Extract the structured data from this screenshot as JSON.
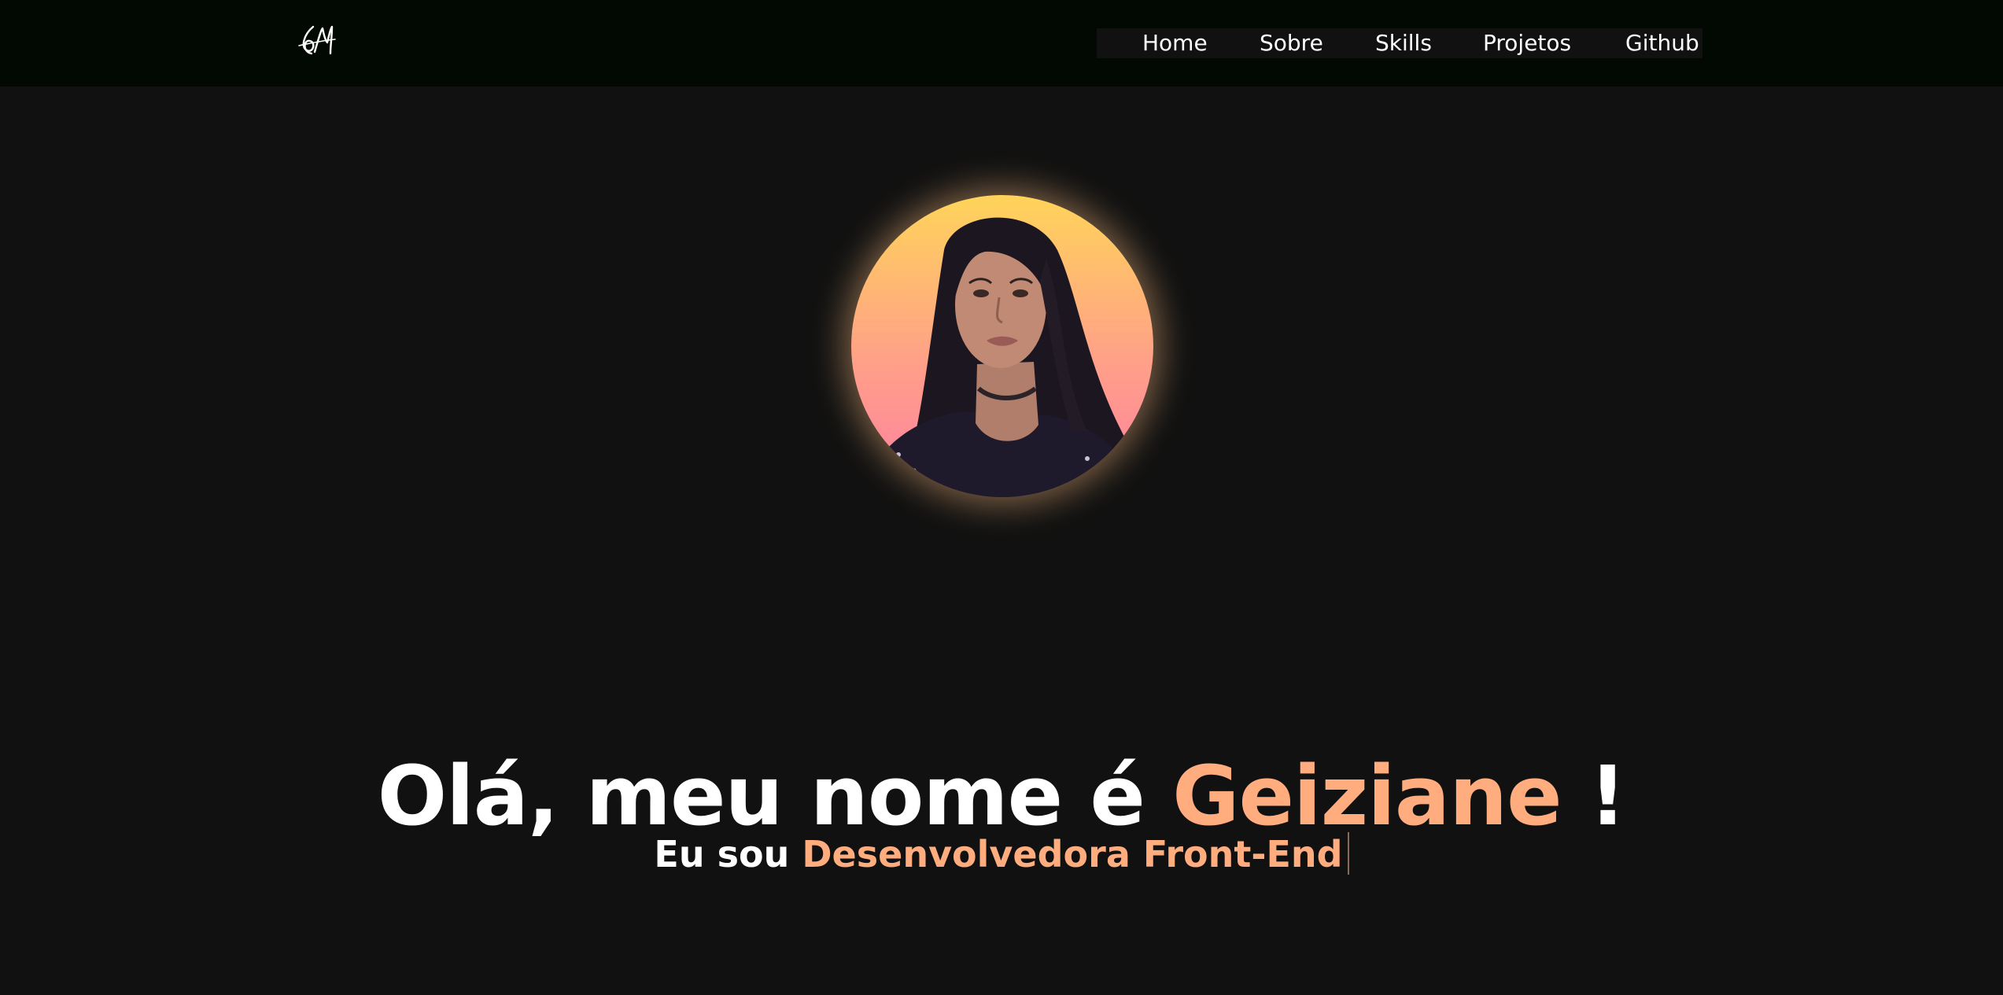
{
  "header": {
    "logo_icon": "signature-logo-icon",
    "nav": [
      {
        "label": "Home"
      },
      {
        "label": "Sobre"
      },
      {
        "label": "Skills"
      },
      {
        "label": "Projetos"
      },
      {
        "label": "Github"
      }
    ]
  },
  "hero": {
    "avatar_icon": "profile-photo",
    "title_prefix": "Olá, meu nome é",
    "title_name": "Geiziane",
    "title_suffix": "!",
    "subtitle_prefix": "Eu sou",
    "subtitle_role": "Desenvolvedora Front-End"
  },
  "colors": {
    "page_background": "#111111",
    "header_background": "#020802",
    "accent": "#ffad7f",
    "text": "#ffffff",
    "avatar_gradient_top": "#ffd45a",
    "avatar_gradient_bottom": "#ff7fa2"
  }
}
